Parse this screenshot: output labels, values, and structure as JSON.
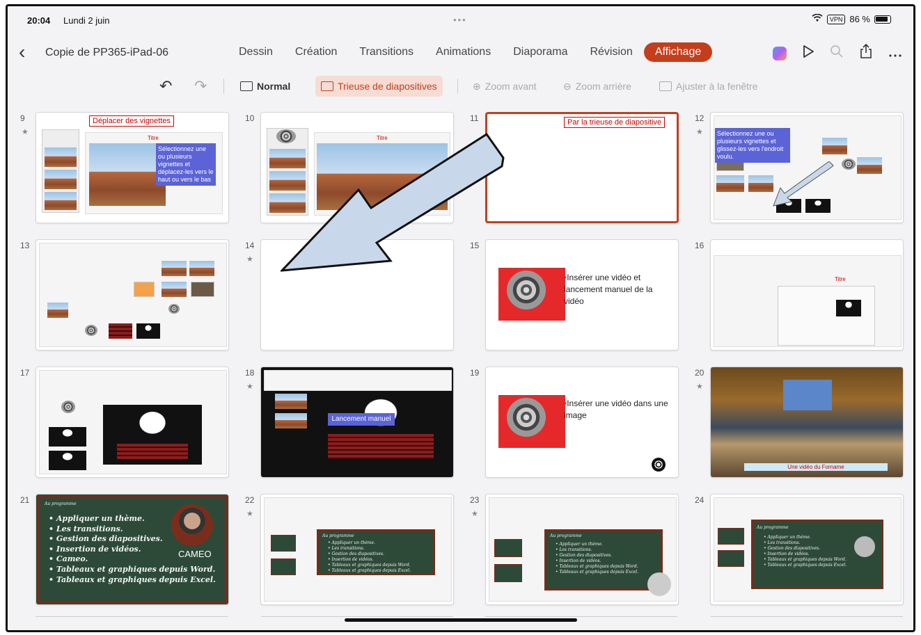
{
  "status": {
    "time": "20:04",
    "date": "Lundi 2 juin",
    "dots": "•••",
    "vpn": "VPN",
    "battery": "86 %"
  },
  "ribbon": {
    "back": "‹",
    "doc_title": "Copie de PP365-iPad-06",
    "tabs": [
      {
        "label": "Dessin"
      },
      {
        "label": "Création"
      },
      {
        "label": "Transitions"
      },
      {
        "label": "Animations"
      },
      {
        "label": "Diaporama"
      },
      {
        "label": "Révision"
      },
      {
        "label": "Affichage",
        "active": true
      }
    ],
    "icons": [
      "copilot-icon",
      "play-icon",
      "search-icon",
      "share-icon",
      "more-icon"
    ]
  },
  "toolbar": {
    "undo": "↶",
    "redo": "↷",
    "normal": "Normal",
    "sorter": "Trieuse de diapositives",
    "zoom_in": "Zoom avant",
    "zoom_out": "Zoom arrière",
    "fit": "Ajuster à la fenêtre"
  },
  "slides": [
    {
      "num": "9",
      "star": "★",
      "label": "Déplacer des vignettes",
      "title": "Titre",
      "note": "Sélectionnez une ou plusieurs vignettes et déplacez-les vers le haut ou vers le bas"
    },
    {
      "num": "10",
      "star": "",
      "title": "Titre"
    },
    {
      "num": "11",
      "star": "",
      "label": "Par la trieuse de diapositive",
      "selected": true
    },
    {
      "num": "12",
      "star": "★",
      "note": "Sélectionnez une ou plusieurs vignettes et glissez-les vers l'endroit voulu."
    },
    {
      "num": "13",
      "star": ""
    },
    {
      "num": "14",
      "star": "★"
    },
    {
      "num": "15",
      "star": "",
      "text": "Insérer une vidéo et lancement manuel de la vidéo"
    },
    {
      "num": "16",
      "star": "",
      "title": "Titre"
    },
    {
      "num": "17",
      "star": ""
    },
    {
      "num": "18",
      "star": "★",
      "note": "Lancement manuel"
    },
    {
      "num": "19",
      "star": "",
      "text": "Insérer une vidéo dans une image"
    },
    {
      "num": "20",
      "star": "★",
      "caption": "Une vidéo du Forname"
    },
    {
      "num": "21",
      "star": "",
      "cameo": "CAMEO",
      "heading": "Au programme"
    },
    {
      "num": "22",
      "star": "★",
      "heading": "Au programme"
    },
    {
      "num": "23",
      "star": "★",
      "heading": "Au programme"
    },
    {
      "num": "24",
      "star": "",
      "heading": "Au programme"
    }
  ],
  "program": [
    "Appliquer un thème.",
    "Les transitions.",
    "Gestion des diapositives.",
    "Insertion de vidéos.",
    "Cameo.",
    "Tableaux et graphiques depuis Word.",
    "Tableaux et graphiques depuis Excel."
  ],
  "colors": {
    "accent": "#c43e1c",
    "arrow_fill": "#c8d8ea"
  }
}
